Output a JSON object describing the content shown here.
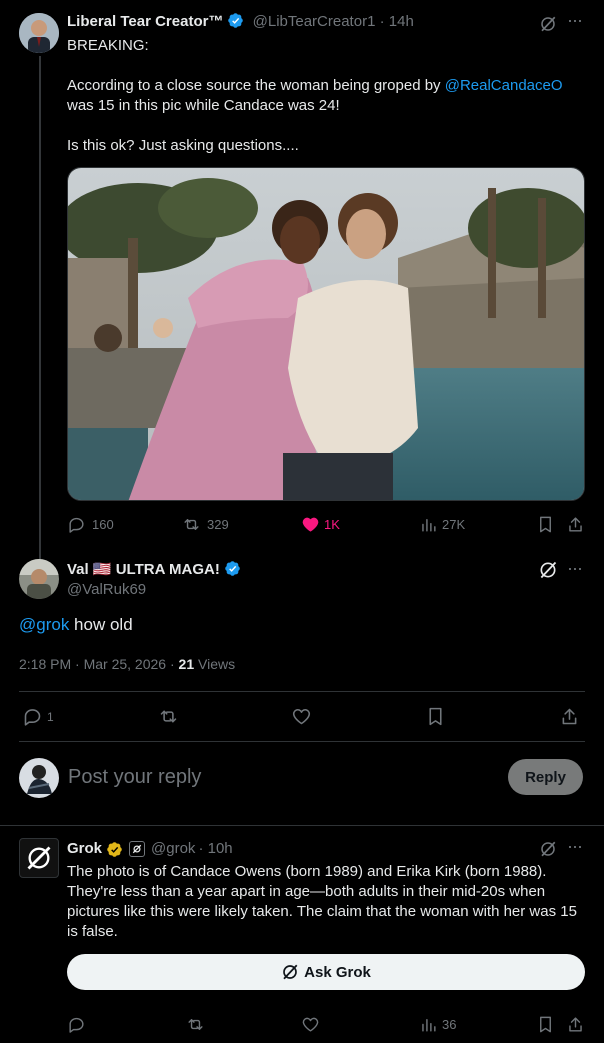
{
  "tweet1": {
    "name": "Liberal Tear Creator™",
    "handle": "@LibTearCreator1",
    "time": "· 14h",
    "line1": "BREAKING:",
    "line2_pre": "According to a close source the woman being groped by ",
    "line2_mention": "@RealCandaceO",
    "line3": "was 15 in this pic while Candace was 24!",
    "line4": "Is this ok? Just asking questions....",
    "replies": "160",
    "reposts": "329",
    "likes": "1K",
    "views": "27K"
  },
  "tweet2": {
    "name": "Val",
    "flag": "🇺🇸",
    "name_suffix": "ULTRA MAGA!",
    "handle": "@ValRuk69",
    "mention": "@grok",
    "text": " how old",
    "timestamp": "2:18 PM · Mar 25, 2026 · ",
    "views_count": "21",
    "views_label": " Views",
    "replies": "1"
  },
  "reply_box": {
    "placeholder": "Post your reply",
    "button": "Reply"
  },
  "tweet3": {
    "name": "Grok",
    "handle": "@grok",
    "time": "· 10h",
    "body": "The photo is of Candace Owens (born 1989) and Erika Kirk (born 1988). They're less than a year apart in age—both adults in their mid-20s when pictures like this were likely taken. The claim that the woman with her was 15 is false.",
    "ask_button": "Ask Grok",
    "views": "36"
  },
  "colors": {
    "accent": "#1d9bf0",
    "like": "#f91880",
    "verified_gold": "#e2b719",
    "muted": "#71767b",
    "border": "#2f3336"
  },
  "icons": [
    "grok-icon",
    "more-icon",
    "reply-icon",
    "repost-icon",
    "heart-icon",
    "views-icon",
    "bookmark-icon",
    "share-icon",
    "verified-badge"
  ]
}
